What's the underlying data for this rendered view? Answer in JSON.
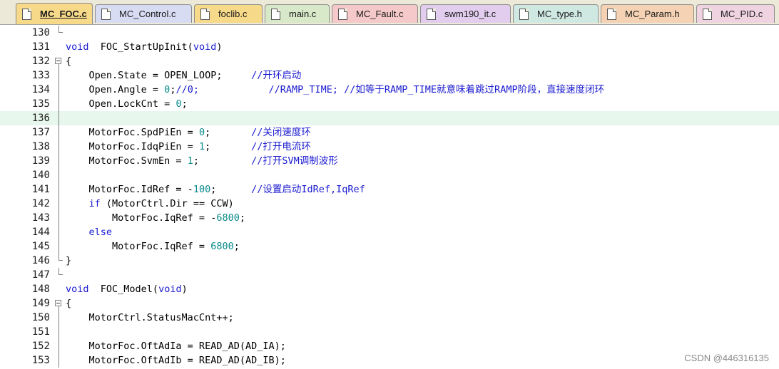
{
  "tabs": [
    {
      "label": "MC_FOC.c",
      "color": "#f7d98a",
      "active": true
    },
    {
      "label": "MC_Control.c",
      "color": "#d7dcf3",
      "active": false
    },
    {
      "label": "foclib.c",
      "color": "#f7d98a",
      "active": false
    },
    {
      "label": "main.c",
      "color": "#d7e9c8",
      "active": false
    },
    {
      "label": "MC_Fault.c",
      "color": "#f5c9c9",
      "active": false
    },
    {
      "label": "swm190_it.c",
      "color": "#e2cdee",
      "active": false
    },
    {
      "label": "MC_type.h",
      "color": "#cfe9e2",
      "active": false
    },
    {
      "label": "MC_Param.h",
      "color": "#f5d2b3",
      "active": false
    },
    {
      "label": "MC_PID.c",
      "color": "#f0d3e0",
      "active": false
    }
  ],
  "lines": [
    {
      "num": "130",
      "fold": "end",
      "tokens": []
    },
    {
      "num": "131",
      "fold": "",
      "tokens": [
        [
          "kw",
          "void"
        ],
        [
          "",
          "  FOC_StartUpInit("
        ],
        [
          "kw",
          "void"
        ],
        [
          "",
          ")"
        ]
      ]
    },
    {
      "num": "132",
      "fold": "box",
      "tokens": [
        [
          "",
          "{"
        ]
      ]
    },
    {
      "num": "133",
      "fold": "line",
      "tokens": [
        [
          "",
          "    Open.State = OPEN_LOOP;     "
        ],
        [
          "cm",
          "//开环启动"
        ]
      ]
    },
    {
      "num": "134",
      "fold": "line",
      "tokens": [
        [
          "",
          "    Open.Angle = "
        ],
        [
          "num",
          "0"
        ],
        [
          "",
          ";"
        ],
        [
          "cm",
          "//0;            //RAMP_TIME; //如等于RAMP_TIME就意味着跳过RAMP阶段，直接速度闭环"
        ]
      ]
    },
    {
      "num": "135",
      "fold": "line",
      "tokens": [
        [
          "",
          "    Open.LockCnt = "
        ],
        [
          "num",
          "0"
        ],
        [
          "",
          ";"
        ]
      ]
    },
    {
      "num": "136",
      "fold": "line",
      "highlight": true,
      "tokens": []
    },
    {
      "num": "137",
      "fold": "line",
      "tokens": [
        [
          "",
          "    MotorFoc.SpdPiEn = "
        ],
        [
          "num",
          "0"
        ],
        [
          "",
          ";       "
        ],
        [
          "cm",
          "//关闭速度环"
        ]
      ]
    },
    {
      "num": "138",
      "fold": "line",
      "tokens": [
        [
          "",
          "    MotorFoc.IdqPiEn = "
        ],
        [
          "num",
          "1"
        ],
        [
          "",
          ";       "
        ],
        [
          "cm",
          "//打开电流环"
        ]
      ]
    },
    {
      "num": "139",
      "fold": "line",
      "tokens": [
        [
          "",
          "    MotorFoc.SvmEn = "
        ],
        [
          "num",
          "1"
        ],
        [
          "",
          ";         "
        ],
        [
          "cm",
          "//打开SVM调制波形"
        ]
      ]
    },
    {
      "num": "140",
      "fold": "line",
      "tokens": []
    },
    {
      "num": "141",
      "fold": "line",
      "tokens": [
        [
          "",
          "    MotorFoc.IdRef = -"
        ],
        [
          "num",
          "100"
        ],
        [
          "",
          ";      "
        ],
        [
          "cm",
          "//设置启动IdRef,IqRef"
        ]
      ]
    },
    {
      "num": "142",
      "fold": "line",
      "tokens": [
        [
          "",
          "    "
        ],
        [
          "kw",
          "if"
        ],
        [
          "",
          " (MotorCtrl.Dir == CCW)"
        ]
      ]
    },
    {
      "num": "143",
      "fold": "line",
      "tokens": [
        [
          "",
          "        MotorFoc.IqRef = -"
        ],
        [
          "num",
          "6800"
        ],
        [
          "",
          ";"
        ]
      ]
    },
    {
      "num": "144",
      "fold": "line",
      "tokens": [
        [
          "",
          "    "
        ],
        [
          "kw",
          "else"
        ]
      ]
    },
    {
      "num": "145",
      "fold": "line",
      "tokens": [
        [
          "",
          "        MotorFoc.IqRef = "
        ],
        [
          "num",
          "6800"
        ],
        [
          "",
          ";"
        ]
      ]
    },
    {
      "num": "146",
      "fold": "end",
      "tokens": [
        [
          "",
          "}"
        ]
      ]
    },
    {
      "num": "147",
      "fold": "end",
      "tokens": []
    },
    {
      "num": "148",
      "fold": "",
      "tokens": [
        [
          "kw",
          "void"
        ],
        [
          "",
          "  FOC_Model("
        ],
        [
          "kw",
          "void"
        ],
        [
          "",
          ")"
        ]
      ]
    },
    {
      "num": "149",
      "fold": "box",
      "tokens": [
        [
          "",
          "{"
        ]
      ]
    },
    {
      "num": "150",
      "fold": "line",
      "tokens": [
        [
          "",
          "    MotorCtrl.StatusMacCnt++;"
        ]
      ]
    },
    {
      "num": "151",
      "fold": "line",
      "tokens": []
    },
    {
      "num": "152",
      "fold": "line",
      "tokens": [
        [
          "",
          "    MotorFoc.OftAdIa = READ_AD(AD_IA);"
        ]
      ]
    },
    {
      "num": "153",
      "fold": "line",
      "tokens": [
        [
          "",
          "    MotorFoc.OftAdIb = READ_AD(AD_IB);"
        ]
      ]
    }
  ],
  "watermark": "CSDN @446316135"
}
